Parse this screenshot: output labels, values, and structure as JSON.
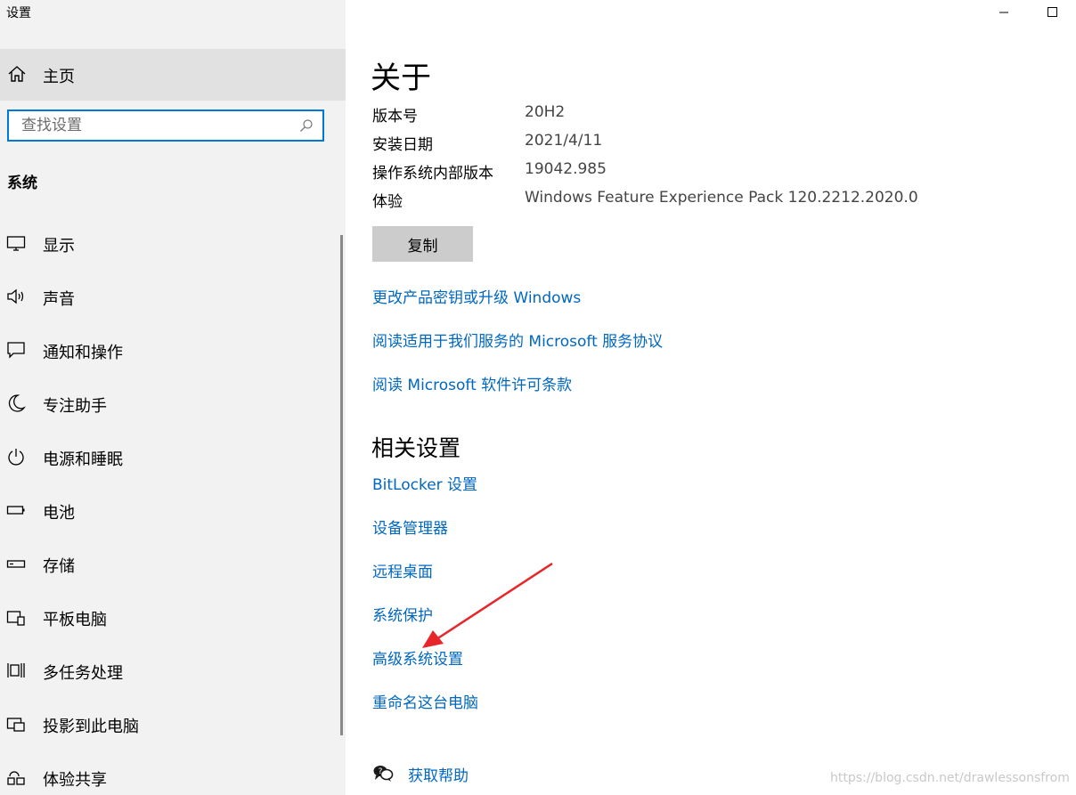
{
  "window": {
    "title": "设置",
    "controls": [
      "minimize-icon",
      "maximize-icon"
    ]
  },
  "sidebar": {
    "home_label": "主页",
    "search_placeholder": "查找设置",
    "section_title": "系统",
    "items": [
      {
        "label": "显示",
        "icon": "display-icon"
      },
      {
        "label": "声音",
        "icon": "speaker-icon"
      },
      {
        "label": "通知和操作",
        "icon": "notification-icon"
      },
      {
        "label": "专注助手",
        "icon": "moon-icon"
      },
      {
        "label": "电源和睡眠",
        "icon": "power-icon"
      },
      {
        "label": "电池",
        "icon": "battery-icon"
      },
      {
        "label": "存储",
        "icon": "storage-icon"
      },
      {
        "label": "平板电脑",
        "icon": "tablet-icon"
      },
      {
        "label": "多任务处理",
        "icon": "multitask-icon"
      },
      {
        "label": "投影到此电脑",
        "icon": "project-icon"
      },
      {
        "label": "体验共享",
        "icon": "share-icon"
      }
    ]
  },
  "main": {
    "title": "关于",
    "info": [
      {
        "key": "版本号",
        "value": "20H2"
      },
      {
        "key": "安装日期",
        "value": "2021/4/11"
      },
      {
        "key": "操作系统内部版本",
        "value": "19042.985"
      },
      {
        "key": "体验",
        "value": "Windows Feature Experience Pack 120.2212.2020.0"
      }
    ],
    "copy_label": "复制",
    "links": [
      "更改产品密钥或升级 Windows",
      "阅读适用于我们服务的 Microsoft 服务协议",
      "阅读 Microsoft 软件许可条款"
    ],
    "related_title": "相关设置",
    "related_links": [
      "BitLocker 设置",
      "设备管理器",
      "远程桌面",
      "系统保护",
      "高级系统设置",
      "重命名这台电脑"
    ],
    "help_label": "获取帮助"
  },
  "watermark": "https://blog.csdn.net/drawlessonsfrom",
  "colors": {
    "accent": "#0078d7",
    "link": "#0067c0",
    "sidebar_bg": "#f2f2f2",
    "selected_bg": "#e1e1e1",
    "annotation_arrow": "#e8262a"
  }
}
